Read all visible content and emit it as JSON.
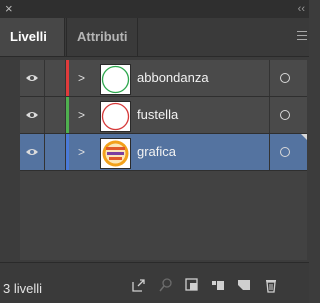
{
  "window": {
    "close_glyph": "×",
    "collapse_glyph": "‹‹"
  },
  "tabs": [
    {
      "label": "Livelli",
      "active": true
    },
    {
      "label": "Attributi",
      "active": false
    }
  ],
  "layers": [
    {
      "name": "abbondanza",
      "color": "#e03b3b",
      "thumb": "green-circle",
      "selected": false
    },
    {
      "name": "fustella",
      "color": "#4fb04f",
      "thumb": "red-circle",
      "selected": false
    },
    {
      "name": "grafica",
      "color": "#4a7ad8",
      "thumb": "graphic-badge",
      "selected": true
    }
  ],
  "footer": {
    "count_label": "3 livelli",
    "icons": [
      "export-icon",
      "locate-object-icon",
      "clipping-mask-icon",
      "new-sublayer-icon",
      "new-layer-icon",
      "delete-icon"
    ]
  },
  "thumb_colors": {
    "green": "#2fa84f",
    "red": "#d63b3b",
    "badge_orange": "#f2a11b",
    "badge_purple": "#7b3fa0"
  }
}
